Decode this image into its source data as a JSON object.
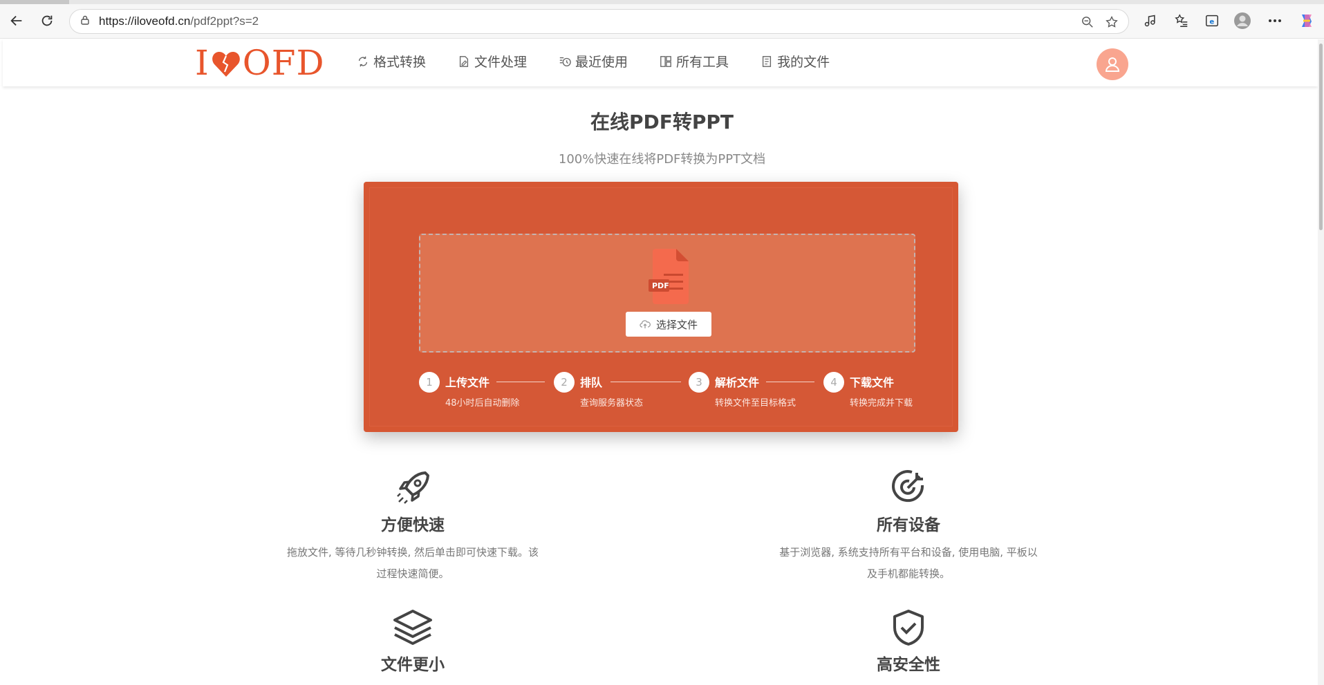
{
  "browser": {
    "url_host": "https://iloveofd.cn",
    "url_path": "/pdf2ppt?s=2"
  },
  "site": {
    "logo_text_left": "I",
    "logo_text_right": "OFD",
    "brand_color": "#e8552c",
    "nav": [
      {
        "label": "格式转换",
        "icon": "convert-icon"
      },
      {
        "label": "文件处理",
        "icon": "file-edit-icon"
      },
      {
        "label": "最近使用",
        "icon": "recent-icon"
      },
      {
        "label": "所有工具",
        "icon": "grid-icon"
      },
      {
        "label": "我的文件",
        "icon": "document-icon"
      }
    ]
  },
  "main": {
    "title": "在线PDF转PPT",
    "subtitle": "100%快速在线将PDF转换为PPT文档",
    "pdf_badge": "PDF",
    "choose_button": "选择文件",
    "steps": [
      {
        "num": "1",
        "title": "上传文件",
        "desc": "48小时后自动删除"
      },
      {
        "num": "2",
        "title": "排队",
        "desc": "查询服务器状态"
      },
      {
        "num": "3",
        "title": "解析文件",
        "desc": "转换文件至目标格式"
      },
      {
        "num": "4",
        "title": "下载文件",
        "desc": "转换完成并下载"
      }
    ]
  },
  "features": [
    {
      "icon": "rocket-icon",
      "title": "方便快速",
      "desc_line1": "拖放文件, 等待几秒钟转换, 然后单击即可快速下载。该",
      "desc_line2": "过程快速简便。"
    },
    {
      "icon": "target-icon",
      "title": "所有设备",
      "desc_line1": "基于浏览器, 系统支持所有平台和设备, 使用电脑, 平板以",
      "desc_line2": "及手机都能转换。"
    },
    {
      "icon": "layers-icon",
      "title": "文件更小"
    },
    {
      "icon": "shield-icon",
      "title": "高安全性"
    }
  ]
}
